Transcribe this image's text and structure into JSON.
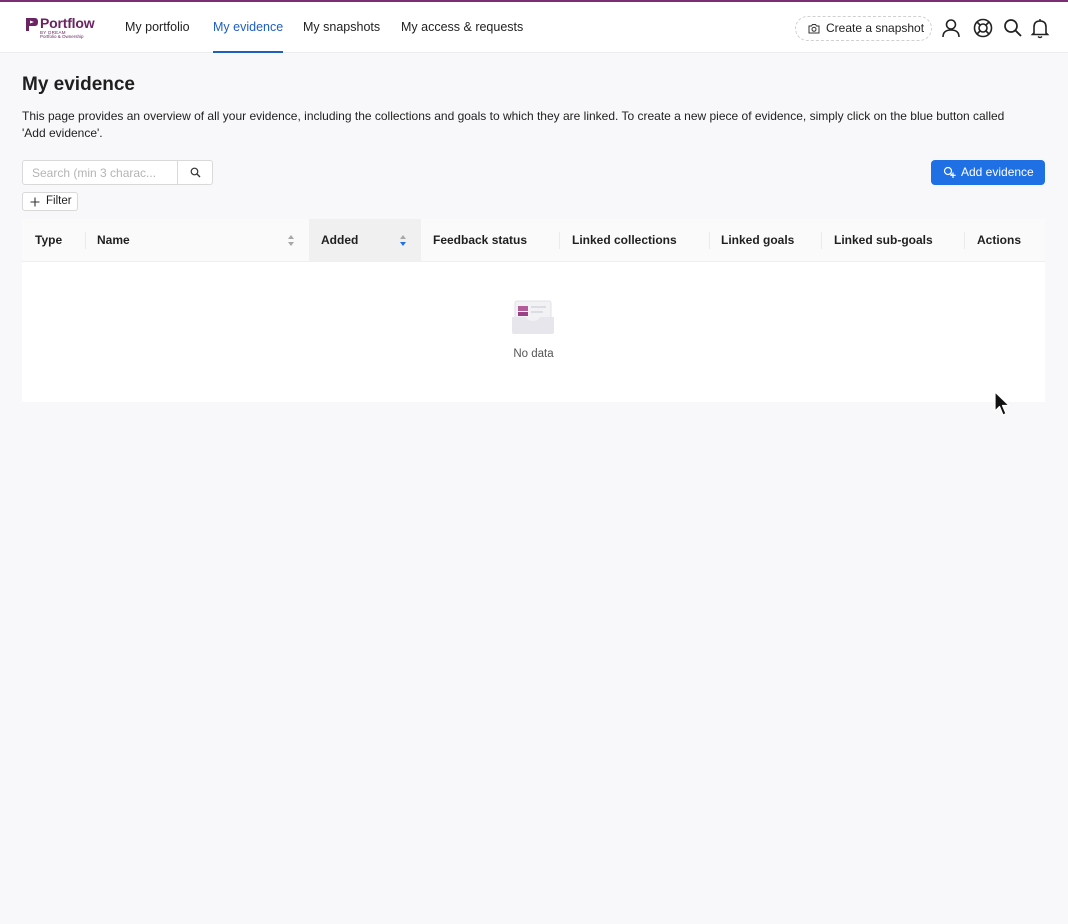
{
  "brand": {
    "name": "Portflow",
    "sub_line1": "BY DREAM",
    "sub_line2": "Portfolio & Ownership",
    "accent_color": "#7a2e73"
  },
  "nav": {
    "items": [
      {
        "label": "My portfolio",
        "active": false
      },
      {
        "label": "My evidence",
        "active": true
      },
      {
        "label": "My snapshots",
        "active": false
      },
      {
        "label": "My access & requests",
        "active": false
      }
    ],
    "active_color": "#1f5fbf"
  },
  "header": {
    "snapshot_label": "Create a snapshot",
    "icons": [
      "user-icon",
      "help-icon",
      "search-icon",
      "bell-icon"
    ]
  },
  "page": {
    "title": "My evidence",
    "description": "This page provides an overview of all your evidence, including the collections and goals to which they are linked. To create a new piece of evidence, simply click on the blue button called 'Add evidence'."
  },
  "toolbar": {
    "search_placeholder": "Search (min 3 charac...",
    "filter_label": "Filter",
    "add_label": "Add evidence",
    "add_color": "#1f6fe5"
  },
  "table": {
    "columns": [
      {
        "label": "Type"
      },
      {
        "label": "Name",
        "sortable": true
      },
      {
        "label": "Added",
        "sortable": true,
        "sorted": "descending"
      },
      {
        "label": "Feedback status"
      },
      {
        "label": "Linked collections"
      },
      {
        "label": "Linked goals"
      },
      {
        "label": "Linked sub-goals"
      },
      {
        "label": "Actions"
      }
    ],
    "rows": [],
    "empty_text": "No data"
  }
}
